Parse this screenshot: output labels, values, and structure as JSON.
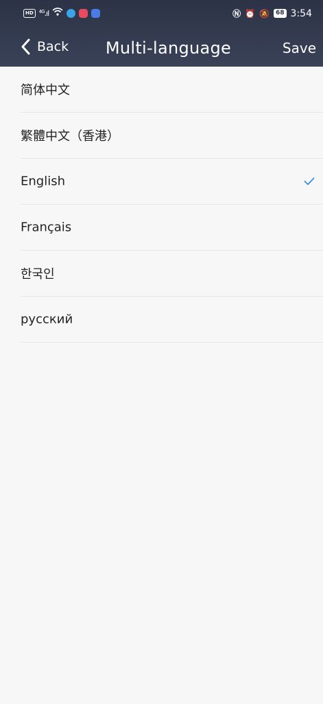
{
  "status_bar": {
    "time": "3:54",
    "battery": "68",
    "network": "4G"
  },
  "nav": {
    "back_label": "Back",
    "title": "Multi-language",
    "save_label": "Save"
  },
  "languages": [
    {
      "label": "简体中文",
      "selected": false
    },
    {
      "label": "繁體中文（香港）",
      "selected": false
    },
    {
      "label": "English",
      "selected": true
    },
    {
      "label": "Français",
      "selected": false
    },
    {
      "label": "한국인",
      "selected": false
    },
    {
      "label": "русский",
      "selected": false
    }
  ],
  "colors": {
    "header": "#2c3346",
    "check": "#3a8ee6",
    "background": "#f7f7f7"
  }
}
